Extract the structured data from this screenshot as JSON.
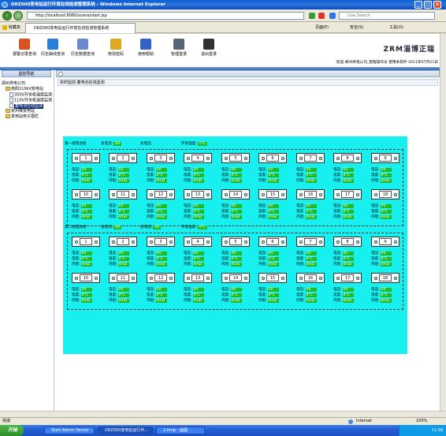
{
  "window": {
    "title": "DRZ000变电站运行环境在线检测管理系统 - Windows Internet Explorer"
  },
  "browser": {
    "url": "http://localhost:8080/scene/start.jsp",
    "search_placeholder": "Live Search",
    "favorites_label": "收藏夹",
    "tab_title": "DRZ000变电站运行环境在线检测管理系统",
    "menu_right": [
      "页面(P)",
      "安全(S)",
      "工具(O)"
    ]
  },
  "app": {
    "toolbar": [
      {
        "label": "报警记录查询",
        "color": "#d9531e"
      },
      {
        "label": "历史曲线查询",
        "color": "#2a7fd4"
      },
      {
        "label": "历史数据查询",
        "color": "#6a8ad0"
      },
      {
        "label": "修改密码",
        "color": "#e0a820"
      },
      {
        "label": "使用帮助",
        "color": "#3560c8"
      },
      {
        "label": "管理登录",
        "color": "#556677"
      },
      {
        "label": "退出登录",
        "color": "#333333"
      }
    ],
    "brand": "ZRM淄博正瑞",
    "welcome": "欢迎:郑州供电公司_管理操作员 使用本软件 2011年07月21日"
  },
  "sidebar": {
    "header": "监控导航",
    "tree": [
      {
        "label": "郑州供电公司",
        "level": 0,
        "kind": "root"
      },
      {
        "label": "南阳110kV变电站",
        "level": 1,
        "kind": "folder"
      },
      {
        "label": "350V开关柜温度监测",
        "level": 2,
        "kind": "doc"
      },
      {
        "label": "110V开关柜温度监测",
        "level": 2,
        "kind": "doc"
      },
      {
        "label": "蓄电池在线监测",
        "level": 2,
        "kind": "doc",
        "selected": true
      },
      {
        "label": "泉州降变电站",
        "level": 1,
        "kind": "folder"
      },
      {
        "label": "变电站电子围栏",
        "level": 1,
        "kind": "folder"
      }
    ]
  },
  "main": {
    "title": "实时监控:蓄电池在线监测",
    "groups": [
      {
        "name": "第一组电池组",
        "total_current_label": "总电流:",
        "total_current": "0A",
        "total_voltage_label": "总电压:",
        "total_voltage": "",
        "env_temp_label": "环境温度:",
        "env_temp": "0°C",
        "cells": [
          "1",
          "2",
          "3",
          "4",
          "5",
          "6",
          "7",
          "8",
          "9",
          "10",
          "11",
          "12",
          "13",
          "14",
          "15",
          "16",
          "17",
          "18"
        ]
      },
      {
        "name": "第二组电池组",
        "total_current_label": "总电流:",
        "total_current": "0A",
        "total_voltage_label": "总电压:",
        "total_voltage": "0V",
        "env_temp_label": "环境温度:",
        "env_temp": "0°C",
        "cells": [
          "1",
          "2",
          "3",
          "4",
          "5",
          "6",
          "7",
          "8",
          "9",
          "10",
          "11",
          "12",
          "13",
          "14",
          "15",
          "16",
          "17",
          "18"
        ]
      }
    ],
    "cell_fields": {
      "voltage_label": "电压:",
      "voltage": "0V",
      "temp_label": "温度:",
      "temp": "0°C",
      "resistance_label": "内阻:",
      "resistance": "0mΩ"
    }
  },
  "statusbar": {
    "left": "完成",
    "zone": "Internet",
    "zoom": "100%"
  },
  "taskbar": {
    "start": "开始",
    "tasks": [
      "Start Admin Server ...",
      "DRZ000变电站运行环...",
      "2.bmp - 画图"
    ],
    "clock": "11:58"
  }
}
